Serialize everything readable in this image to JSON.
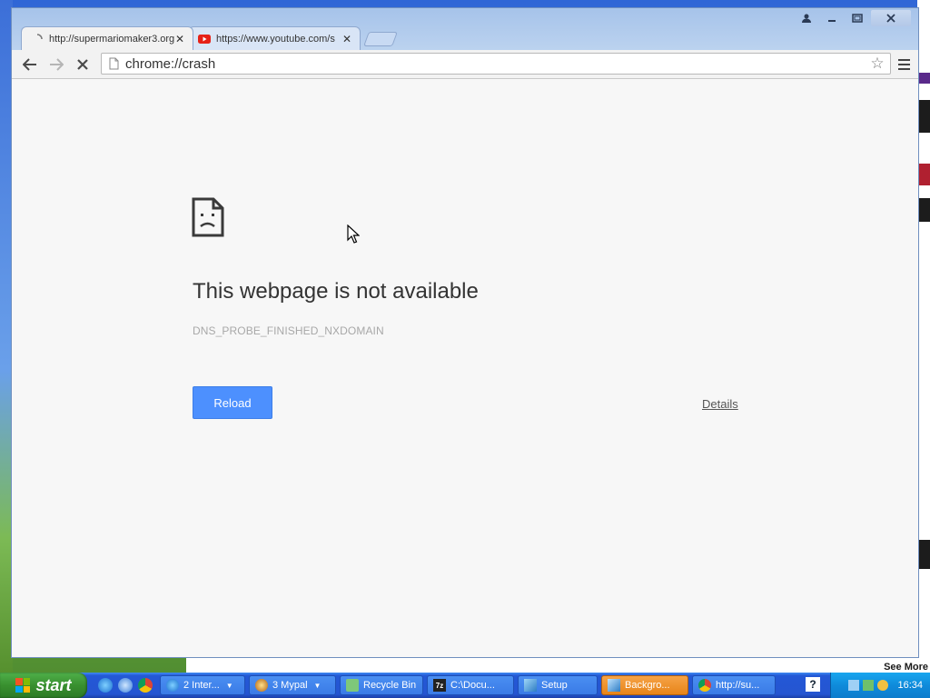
{
  "browser": {
    "tabs": [
      {
        "title": "http://supermariomaker3.org",
        "active": true
      },
      {
        "title": "https://www.youtube.com/s",
        "active": false
      }
    ],
    "address": "chrome://crash"
  },
  "error_page": {
    "title": "This webpage is not available",
    "code": "DNS_PROBE_FINISHED_NXDOMAIN",
    "reload_label": "Reload",
    "details_label": "Details"
  },
  "desktop": {
    "see_more": "See More"
  },
  "taskbar": {
    "start_label": "start",
    "tasks": [
      {
        "label": "2 Inter...",
        "icon": "ie-icon"
      },
      {
        "label": "3 Mypal",
        "icon": "mypal-icon"
      },
      {
        "label": "Recycle Bin",
        "icon": "recycle-bin-icon"
      },
      {
        "label": "C:\\Docu...",
        "icon": "7zip-icon"
      },
      {
        "label": "Setup",
        "icon": "setup-icon"
      },
      {
        "label": "Backgro...",
        "icon": "background-icon"
      },
      {
        "label": "http://su...",
        "icon": "chrome-icon"
      }
    ],
    "clock": "16:34"
  },
  "colors": {
    "reload_button": "#4d90fe",
    "taskbar_blue": "#2555d1",
    "start_green": "#39902f",
    "active_task": "#e78419"
  }
}
